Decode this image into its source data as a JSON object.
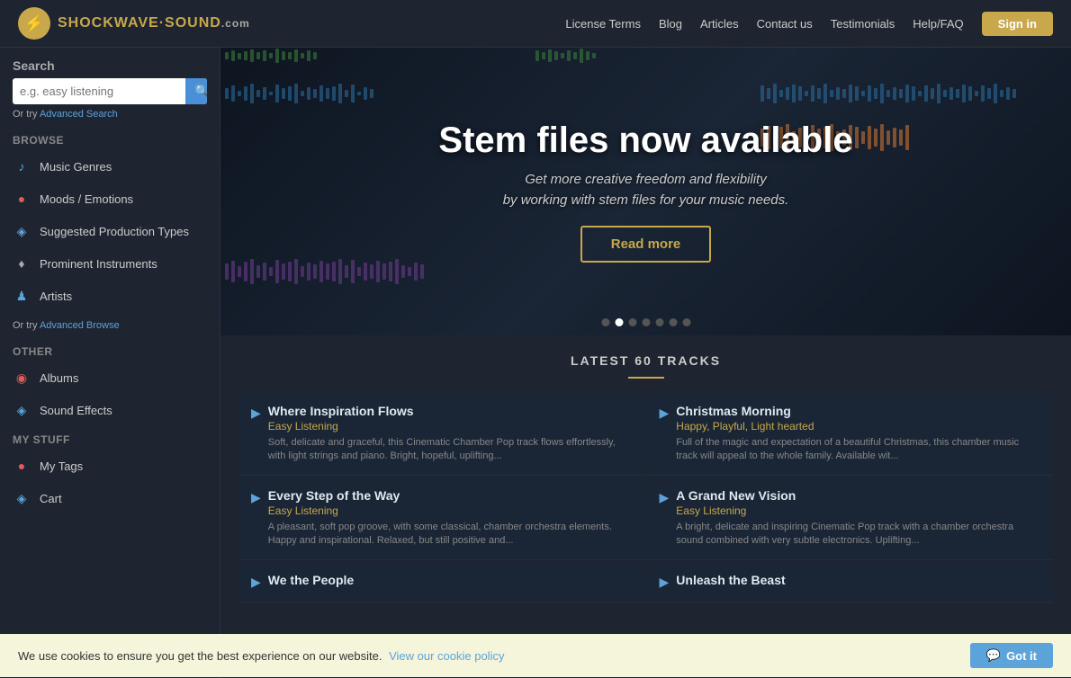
{
  "header": {
    "logo_text": "SHOCKWAVE·SOUND",
    "logo_suffix": ".com",
    "nav_links": [
      "License Terms",
      "Blog",
      "Articles",
      "Contact us",
      "Testimonials",
      "Help/FAQ"
    ],
    "sign_in_label": "Sign in"
  },
  "sidebar": {
    "search_label": "Search",
    "search_placeholder": "e.g. easy listening",
    "search_button_icon": "🔍",
    "or_try_text": "Or try ",
    "advanced_search_link": "Advanced Search",
    "browse_label": "Browse",
    "browse_items": [
      {
        "icon": "♪",
        "label": "Music Genres",
        "icon_class": "icon-music"
      },
      {
        "icon": "●",
        "label": "Moods / Emotions",
        "icon_class": "icon-mood"
      },
      {
        "icon": "◈",
        "label": "Suggested Production Types",
        "icon_class": "icon-prod"
      },
      {
        "icon": "♦",
        "label": "Prominent Instruments",
        "icon_class": "icon-instrument"
      },
      {
        "icon": "♟",
        "label": "Artists",
        "icon_class": "icon-artist"
      }
    ],
    "or_try_browse_text": "Or try ",
    "advanced_browse_link": "Advanced Browse",
    "other_label": "Other",
    "other_items": [
      {
        "icon": "◉",
        "label": "Albums",
        "icon_class": "icon-album"
      },
      {
        "icon": "◈",
        "label": "Sound Effects",
        "icon_class": "icon-sfx"
      }
    ],
    "my_stuff_label": "My Stuff",
    "my_stuff_items": [
      {
        "icon": "●",
        "label": "My Tags",
        "icon_class": "icon-tags"
      },
      {
        "icon": "◈",
        "label": "Cart",
        "icon_class": "icon-cart"
      }
    ]
  },
  "hero": {
    "title": "Stem files now available",
    "subtitle": "Get more creative freedom and flexibility",
    "subtitle2": "by working with stem files for your music needs.",
    "button_label": "Read more",
    "dots": [
      {
        "active": false
      },
      {
        "active": true
      },
      {
        "active": false
      },
      {
        "active": false
      },
      {
        "active": false
      },
      {
        "active": false
      },
      {
        "active": false
      }
    ]
  },
  "latest": {
    "title": "LATEST 60 TRACKS",
    "tracks": [
      {
        "name": "Where Inspiration Flows",
        "genre": "Easy Listening",
        "desc": "Soft, delicate and graceful, this Cinematic Chamber Pop track flows effortlessly, with light strings and piano. Bright, hopeful, uplifting..."
      },
      {
        "name": "Christmas Morning",
        "genre": "Happy, Playful, Light hearted",
        "desc": "Full of the magic and expectation of a beautiful Christmas, this chamber music track will appeal to the whole family. Available wit..."
      },
      {
        "name": "Every Step of the Way",
        "genre": "Easy Listening",
        "desc": "A pleasant, soft pop groove, with some classical, chamber orchestra elements. Happy and inspirational. Relaxed, but still positive and..."
      },
      {
        "name": "A Grand New Vision",
        "genre": "Easy Listening",
        "desc": "A bright, delicate and inspiring Cinematic Pop track with a chamber orchestra sound combined with very subtle electronics. Uplifting..."
      },
      {
        "name": "We the People",
        "genre": "",
        "desc": ""
      },
      {
        "name": "Unleash the Beast",
        "genre": "",
        "desc": ""
      }
    ]
  },
  "cookie": {
    "text": "We use cookies to ensure you get the best experience on our website.",
    "link_text": "View our cookie policy",
    "button_label": "Got it",
    "button_icon": "💬"
  }
}
